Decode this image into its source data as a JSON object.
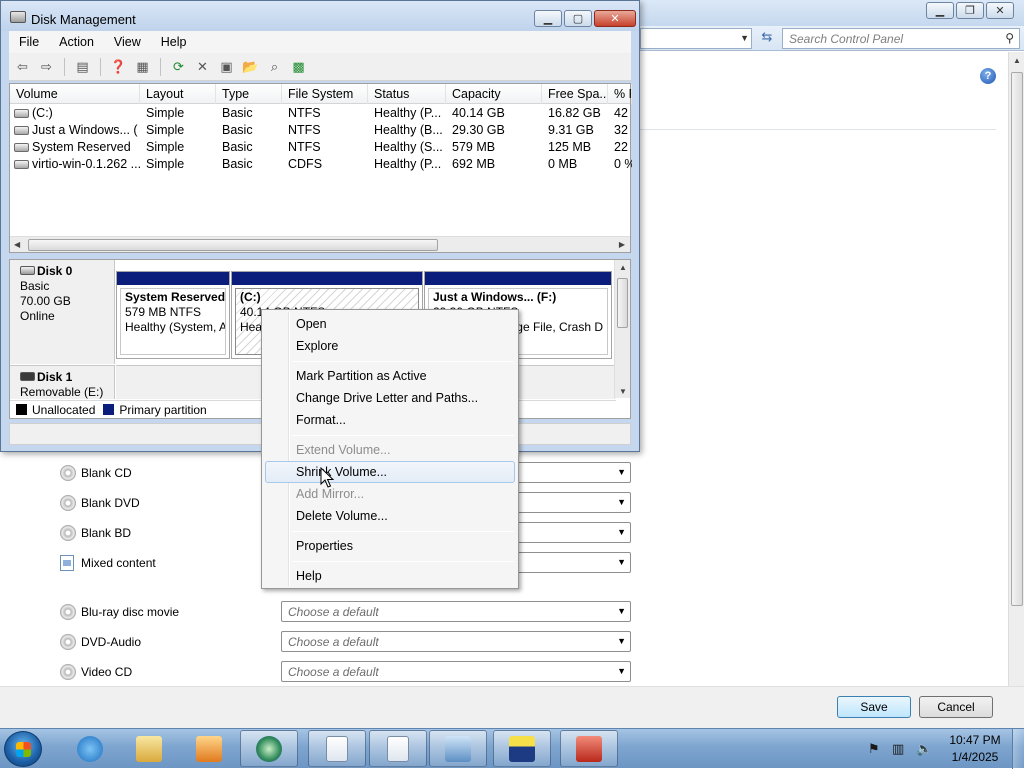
{
  "control_panel": {
    "search_placeholder": "Search Control Panel",
    "media_rows": [
      {
        "label": "Blank CD",
        "icon": "disc-icon",
        "value": ""
      },
      {
        "label": "Blank DVD",
        "icon": "disc-icon",
        "value": ""
      },
      {
        "label": "Blank BD",
        "icon": "disc-icon",
        "value": ""
      },
      {
        "label": "Mixed content",
        "icon": "document-icon",
        "value": ""
      },
      {
        "label": "Blu-ray disc movie",
        "icon": "disc-icon",
        "value": "Choose a default"
      },
      {
        "label": "DVD-Audio",
        "icon": "disc-icon",
        "value": "Choose a default"
      },
      {
        "label": "Video CD",
        "icon": "disc-icon",
        "value": "Choose a default"
      }
    ],
    "save_label": "Save",
    "cancel_label": "Cancel"
  },
  "disk_management": {
    "title": "Disk Management",
    "menu": [
      "File",
      "Action",
      "View",
      "Help"
    ],
    "columns": [
      "Volume",
      "Layout",
      "Type",
      "File System",
      "Status",
      "Capacity",
      "Free Spa...",
      "% F"
    ],
    "volumes": [
      {
        "volume": "(C:)",
        "layout": "Simple",
        "type": "Basic",
        "fs": "NTFS",
        "status": "Healthy (P...",
        "capacity": "40.14 GB",
        "free": "16.82 GB",
        "pct": "42"
      },
      {
        "volume": "Just a Windows... (",
        "layout": "Simple",
        "type": "Basic",
        "fs": "NTFS",
        "status": "Healthy (B...",
        "capacity": "29.30 GB",
        "free": "9.31 GB",
        "pct": "32"
      },
      {
        "volume": "System Reserved",
        "layout": "Simple",
        "type": "Basic",
        "fs": "NTFS",
        "status": "Healthy (S...",
        "capacity": "579 MB",
        "free": "125 MB",
        "pct": "22"
      },
      {
        "volume": "virtio-win-0.1.262 ...",
        "layout": "Simple",
        "type": "Basic",
        "fs": "CDFS",
        "status": "Healthy (P...",
        "capacity": "692 MB",
        "free": "0 MB",
        "pct": "0 %"
      }
    ],
    "disk0": {
      "name": "Disk 0",
      "type": "Basic",
      "size": "70.00 GB",
      "state": "Online"
    },
    "partitions": [
      {
        "name": "System Reserved",
        "line2": "579 MB NTFS",
        "line3": "Healthy (System, A"
      },
      {
        "name": "(C:)",
        "line2": "40.14 GB NTFS",
        "line3": "Heal"
      },
      {
        "name": "Just a Windows...  (F:)",
        "line2": "29.30 GB NTFS",
        "line3": "age File, Crash D"
      }
    ],
    "disk1": {
      "name": "Disk 1",
      "type": "Removable (E:)"
    },
    "legend": [
      {
        "label": "Unallocated",
        "color": "#000000"
      },
      {
        "label": "Primary partition",
        "color": "#0b1e7b"
      }
    ]
  },
  "context_menu": {
    "items": [
      {
        "label": "Open",
        "disabled": false
      },
      {
        "label": "Explore",
        "disabled": false
      },
      {
        "label": "Mark Partition as Active",
        "disabled": false
      },
      {
        "label": "Change Drive Letter and Paths...",
        "disabled": false
      },
      {
        "label": "Format...",
        "disabled": false
      },
      {
        "label": "Extend Volume...",
        "disabled": true
      },
      {
        "label": "Shrink Volume...",
        "disabled": false,
        "hovered": true
      },
      {
        "label": "Add Mirror...",
        "disabled": true
      },
      {
        "label": "Delete Volume...",
        "disabled": false
      },
      {
        "label": "Properties",
        "disabled": false
      },
      {
        "label": "Help",
        "disabled": false
      }
    ]
  },
  "taskbar": {
    "apps": [
      "internet-explorer-icon",
      "file-explorer-icon",
      "media-player-icon",
      "network-globe-icon",
      "blank-document-icon",
      "blank-document-icon",
      "control-panel-icon",
      "floppy-disk-icon",
      "toolbox-icon"
    ],
    "time": "10:47 PM",
    "date": "1/4/2025"
  }
}
